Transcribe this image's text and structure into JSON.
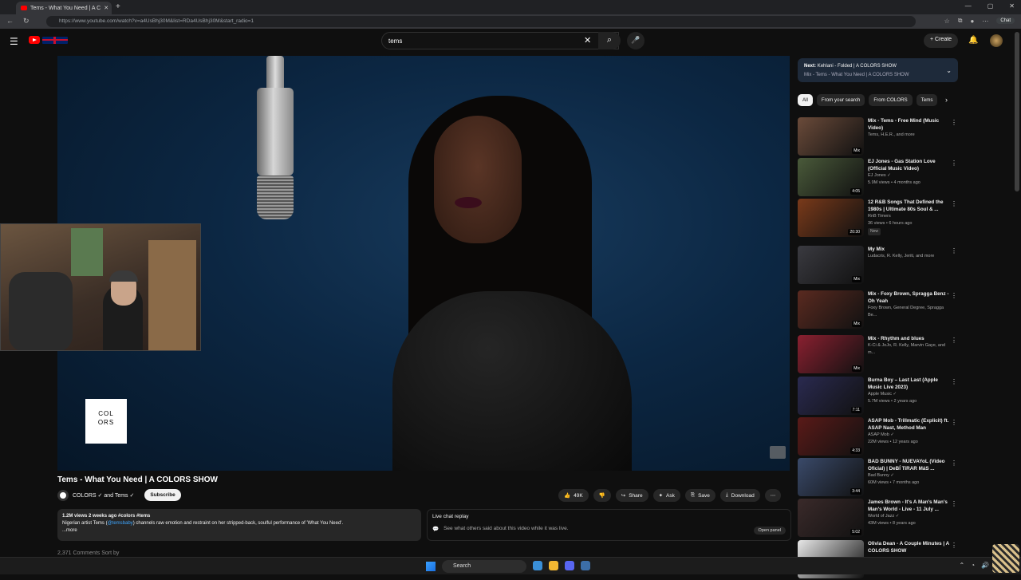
{
  "browser": {
    "tab_title": "Tems - What You Need | A C",
    "url": "https://www.youtube.com/watch?v=a4UsBhj30M&list=RDa4UsBhj30M&start_radio=1",
    "chat_label": "Chat"
  },
  "youtube": {
    "search_value": "tems",
    "create_label": "Create"
  },
  "player": {
    "colors_logo_line1": "COL",
    "colors_logo_line2": "ORS"
  },
  "video": {
    "title": "Tems - What You Need | A COLORS SHOW",
    "channel": "COLORS ✓ and Tems ✓",
    "subscribe_label": "Subscribe",
    "likes": "49K",
    "share_label": "Share",
    "ask_label": "Ask",
    "save_label": "Save",
    "download_label": "Download",
    "meta": "1.2M views  2 weeks ago  #colors #tems",
    "description_pre": "Nigerian artist Tems (",
    "description_handle": "@temsbaby",
    "description_post": ") channels raw emotion and restraint on her stripped-back, soulful performance of 'What You Need'.",
    "more": "...more",
    "comments_peek": "2,371 Comments     Sort by"
  },
  "live_chat": {
    "title": "Live chat replay",
    "subtitle": "See what others said about this video while it was live.",
    "open_panel": "Open panel"
  },
  "sidebar": {
    "next_prefix": "Next:",
    "next_title": "Kehlani - Folded | A COLORS SHOW",
    "next_sub": "Mix - Tems - What You Need | A COLORS SHOW",
    "chips": [
      "All",
      "From your search",
      "From COLORS",
      "Tems"
    ],
    "items": [
      {
        "title": "Mix - Tems - Free Mind (Music Video)",
        "meta1": "Tems, H.E.R., and more",
        "meta2": "",
        "dur": "Mix",
        "color": "#6b4b3a"
      },
      {
        "title": "EJ Jones - Gas Station Love (Official Music Video)",
        "meta1": "EJ Jones ✓",
        "meta2": "5.9M views • 4 months ago",
        "dur": "4:05",
        "color": "#4a5a3a"
      },
      {
        "title": "12 R&B Songs That Defined the 1980s | Ultimate 80s Soul & ...",
        "meta1": "RnB Timers",
        "meta2": "36 views • 6 hours ago",
        "dur": "20:30",
        "color": "#7a3a1a",
        "badge": "New"
      },
      {
        "title": "My Mix",
        "meta1": "Ludacris, R. Kelly, Jeriti, and more",
        "meta2": "",
        "dur": "Mix",
        "color": "#3a3a40"
      },
      {
        "title": "Mix - Foxy Brown, Spragga Benz - Oh Yeah",
        "meta1": "Foxy Brown, General Degree, Spragga Be...",
        "meta2": "",
        "dur": "Mix",
        "color": "#5a2a20"
      },
      {
        "title": "Mix - Rhythm and blues",
        "meta1": "K-Ci & JoJo, R. Kelly, Marvin Gaye, and m...",
        "meta2": "",
        "dur": "Mix",
        "color": "#8a2030"
      },
      {
        "title": "Burna Boy – Last Last (Apple Music Live 2023)",
        "meta1": "Apple Music ✓",
        "meta2": "5.7M views • 2 years ago",
        "dur": "7:11",
        "color": "#2a2a50"
      },
      {
        "title": "ASAP Mob - Trillmatic (Explicit) ft. ASAP Nast, Method Man",
        "meta1": "ASAP Mob ✓",
        "meta2": "22M views • 12 years ago",
        "dur": "4:33",
        "color": "#5a1a18"
      },
      {
        "title": "BAD BUNNY - NUEVAYoL (Video Oficial) | DeBÍ TiRAR MáS ...",
        "meta1": "Bad Bunny ✓",
        "meta2": "60M views • 7 months ago",
        "dur": "3:44",
        "color": "#3a4a6a"
      },
      {
        "title": "James Brown - It's A Man's Man's Man's World - Live - 11 July ...",
        "meta1": "World of Jazz ✓",
        "meta2": "43M views • 8 years ago",
        "dur": "5:02",
        "color": "#3a2a2a"
      },
      {
        "title": "Olivia Dean - A Couple Minutes | A COLORS SHOW",
        "meta1": "",
        "meta2": "",
        "dur": "",
        "color": "#e8e8e8"
      }
    ]
  },
  "taskbar": {
    "search_label": "Search"
  }
}
